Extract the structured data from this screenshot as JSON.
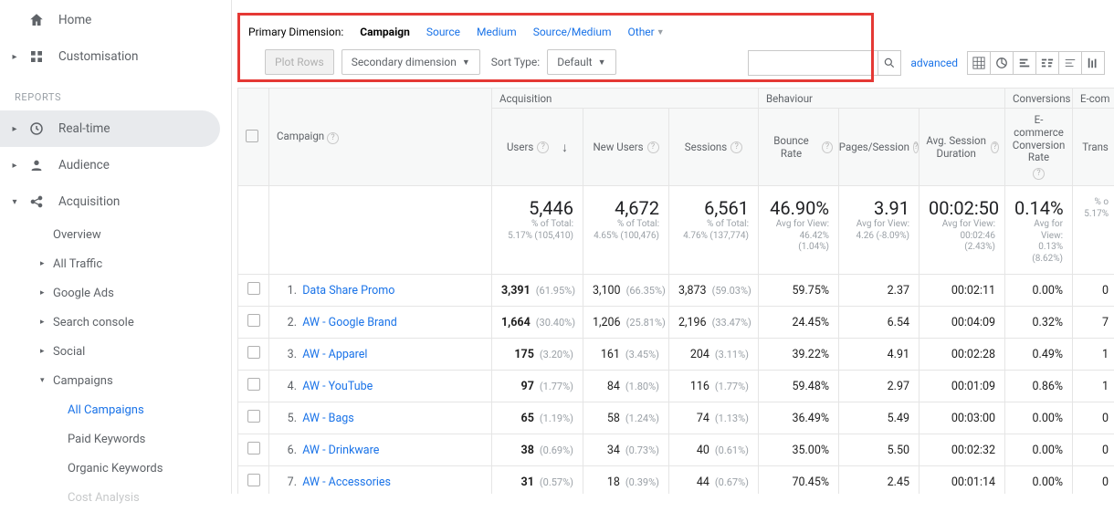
{
  "sidebar": {
    "home": "Home",
    "custom": "Customisation",
    "reports_label": "REPORTS",
    "realtime": "Real-time",
    "audience": "Audience",
    "acquisition": "Acquisition",
    "overview": "Overview",
    "all_traffic": "All Traffic",
    "google_ads": "Google Ads",
    "search_console": "Search console",
    "social": "Social",
    "campaigns": "Campaigns",
    "all_campaigns": "All Campaigns",
    "paid_keywords": "Paid Keywords",
    "organic_keywords": "Organic Keywords",
    "cost_analysis": "Cost Analysis"
  },
  "dimbar": {
    "label": "Primary Dimension:",
    "tabs": [
      "Campaign",
      "Source",
      "Medium",
      "Source/Medium",
      "Other"
    ],
    "plot_rows": "Plot Rows",
    "secondary": "Secondary dimension",
    "sort_label": "Sort Type:",
    "sort_value": "Default",
    "advanced": "advanced"
  },
  "cols": {
    "campaign": "Campaign",
    "acquisition": "Acquisition",
    "behaviour": "Behaviour",
    "conversions": "Conversions",
    "ecom": "E-com",
    "users": "Users",
    "new_users": "New Users",
    "sessions": "Sessions",
    "bounce": "Bounce Rate",
    "pps": "Pages/Session",
    "dur": "Avg. Session Duration",
    "conv_rate": "E-commerce Conversion Rate",
    "trans": "Trans"
  },
  "summary": {
    "users": {
      "v": "5,446",
      "l1": "% of Total:",
      "l2": "5.17% (105,410)"
    },
    "new_users": {
      "v": "4,672",
      "l1": "% of Total:",
      "l2": "4.65% (100,476)"
    },
    "sessions": {
      "v": "6,561",
      "l1": "% of Total:",
      "l2": "4.76% (137,774)"
    },
    "bounce": {
      "v": "46.90%",
      "l1": "Avg for View:",
      "l2": "46.42%",
      "l3": "(1.04%)"
    },
    "pps": {
      "v": "3.91",
      "l1": "Avg for View:",
      "l2": "4.26 (-8.09%)"
    },
    "dur": {
      "v": "00:02:50",
      "l1": "Avg for View:",
      "l2": "00:02:46",
      "l3": "(2.43%)"
    },
    "conv": {
      "v": "0.14%",
      "l1": "Avg for",
      "l2": "View:",
      "l3": "0.13%",
      "l4": "(8.62%)"
    },
    "trans": {
      "v": "",
      "l1": "% o",
      "l2": "5.17%"
    }
  },
  "rows": [
    {
      "i": "1.",
      "name": "Data Share Promo",
      "users": "3,391",
      "users_pct": "(61.95%)",
      "new": "3,100",
      "new_pct": "(66.35%)",
      "sess": "3,873",
      "sess_pct": "(59.03%)",
      "bounce": "59.75%",
      "pps": "2.37",
      "dur": "00:02:11",
      "conv": "0.00%",
      "trans": "0"
    },
    {
      "i": "2.",
      "name": "AW - Google Brand",
      "users": "1,664",
      "users_pct": "(30.40%)",
      "new": "1,206",
      "new_pct": "(25.81%)",
      "sess": "2,196",
      "sess_pct": "(33.47%)",
      "bounce": "24.45%",
      "pps": "6.54",
      "dur": "00:04:09",
      "conv": "0.32%",
      "trans": "7"
    },
    {
      "i": "3.",
      "name": "AW - Apparel",
      "users": "175",
      "users_pct": "(3.20%)",
      "new": "161",
      "new_pct": "(3.45%)",
      "sess": "204",
      "sess_pct": "(3.11%)",
      "bounce": "39.22%",
      "pps": "4.91",
      "dur": "00:02:28",
      "conv": "0.49%",
      "trans": "1"
    },
    {
      "i": "4.",
      "name": "AW - YouTube",
      "users": "97",
      "users_pct": "(1.77%)",
      "new": "84",
      "new_pct": "(1.80%)",
      "sess": "116",
      "sess_pct": "(1.77%)",
      "bounce": "59.48%",
      "pps": "2.97",
      "dur": "00:01:09",
      "conv": "0.86%",
      "trans": "1"
    },
    {
      "i": "5.",
      "name": "AW - Bags",
      "users": "65",
      "users_pct": "(1.19%)",
      "new": "58",
      "new_pct": "(1.24%)",
      "sess": "74",
      "sess_pct": "(1.13%)",
      "bounce": "36.49%",
      "pps": "5.49",
      "dur": "00:03:00",
      "conv": "0.00%",
      "trans": "0"
    },
    {
      "i": "6.",
      "name": "AW - Drinkware",
      "users": "38",
      "users_pct": "(0.69%)",
      "new": "34",
      "new_pct": "(0.73%)",
      "sess": "40",
      "sess_pct": "(0.61%)",
      "bounce": "35.00%",
      "pps": "5.50",
      "dur": "00:02:32",
      "conv": "0.00%",
      "trans": "0"
    },
    {
      "i": "7.",
      "name": "AW - Accessories",
      "users": "31",
      "users_pct": "(0.57%)",
      "new": "18",
      "new_pct": "(0.39%)",
      "sess": "44",
      "sess_pct": "(0.67%)",
      "bounce": "70.45%",
      "pps": "2.45",
      "dur": "00:01:14",
      "conv": "0.00%",
      "trans": "0"
    }
  ]
}
